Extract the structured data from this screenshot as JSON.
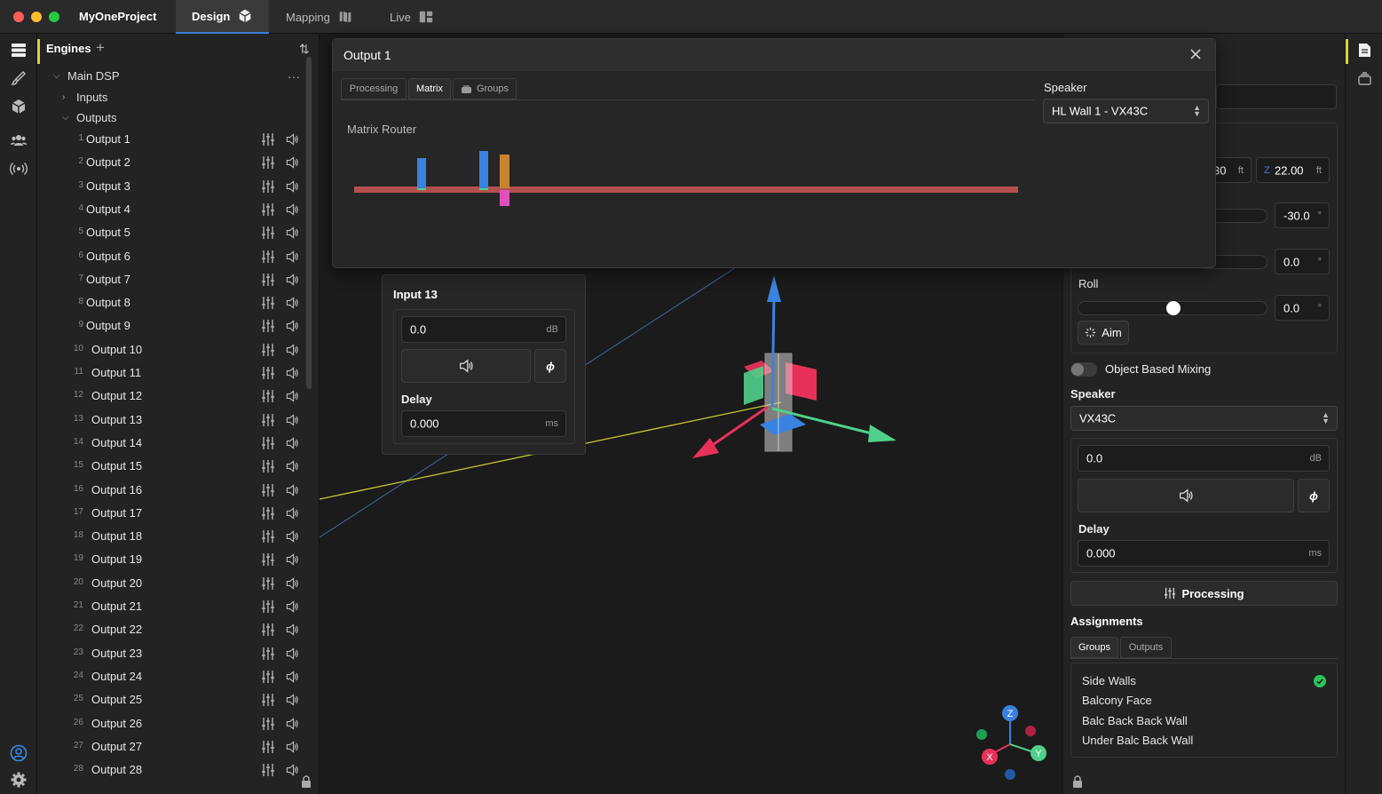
{
  "app": {
    "title": "MyOneProject",
    "tabs": [
      {
        "label": "Design",
        "active": true
      },
      {
        "label": "Mapping",
        "active": false
      },
      {
        "label": "Live",
        "active": false
      }
    ]
  },
  "engines": {
    "header": "Engines",
    "add": "+",
    "sort": "⇅",
    "main_dsp": "Main DSP",
    "more": "···",
    "inputs": "Inputs",
    "outputs": "Outputs",
    "items": [
      {
        "num": "1",
        "label": "Output 1"
      },
      {
        "num": "2",
        "label": "Output 2"
      },
      {
        "num": "3",
        "label": "Output 3"
      },
      {
        "num": "4",
        "label": "Output 4"
      },
      {
        "num": "5",
        "label": "Output 5"
      },
      {
        "num": "6",
        "label": "Output 6"
      },
      {
        "num": "7",
        "label": "Output 7"
      },
      {
        "num": "8",
        "label": "Output 8"
      },
      {
        "num": "9",
        "label": "Output 9"
      },
      {
        "num": "10",
        "label": "Output 10"
      },
      {
        "num": "11",
        "label": "Output 11"
      },
      {
        "num": "12",
        "label": "Output 12"
      },
      {
        "num": "13",
        "label": "Output 13"
      },
      {
        "num": "14",
        "label": "Output 14"
      },
      {
        "num": "15",
        "label": "Output 15"
      },
      {
        "num": "16",
        "label": "Output 16"
      },
      {
        "num": "17",
        "label": "Output 17"
      },
      {
        "num": "18",
        "label": "Output 18"
      },
      {
        "num": "19",
        "label": "Output 19"
      },
      {
        "num": "20",
        "label": "Output 20"
      },
      {
        "num": "21",
        "label": "Output 21"
      },
      {
        "num": "22",
        "label": "Output 22"
      },
      {
        "num": "23",
        "label": "Output 23"
      },
      {
        "num": "24",
        "label": "Output 24"
      },
      {
        "num": "25",
        "label": "Output 25"
      },
      {
        "num": "26",
        "label": "Output 26"
      },
      {
        "num": "27",
        "label": "Output 27"
      },
      {
        "num": "28",
        "label": "Output 28"
      }
    ]
  },
  "dialog": {
    "title": "Output 1",
    "tabs": [
      {
        "label": "Processing",
        "active": false
      },
      {
        "label": "Matrix",
        "active": true
      },
      {
        "label": "Groups",
        "active": false
      }
    ],
    "matrix_label": "Matrix Router",
    "speaker_label": "Speaker",
    "speaker_value": "HL Wall 1 - VX43C"
  },
  "input_panel": {
    "title": "Input 13",
    "gain": "0.0",
    "gain_unit": "dB",
    "delay_label": "Delay",
    "delay": "0.000",
    "delay_unit": "ms",
    "phase": "ϕ"
  },
  "props": {
    "position_x_partial": "30",
    "position_x_unit": "ft",
    "position_z_axis": "Z",
    "position_z": "22.00",
    "position_z_unit": "ft",
    "yaw_value": "-30.0",
    "pitch_value": "0.0",
    "roll_label": "Roll",
    "roll_value": "0.0",
    "deg": "°",
    "roll_fraction": 0.5,
    "aim_label": "Aim",
    "object_mixing_label": "Object Based Mixing",
    "object_mixing_on": false,
    "speaker_label": "Speaker",
    "speaker_value": "VX43C",
    "gain": "0.0",
    "gain_unit": "dB",
    "phase": "ϕ",
    "delay_label": "Delay",
    "delay": "0.000",
    "delay_unit": "ms",
    "processing_label": "Processing",
    "assignments_label": "Assignments",
    "assign_tabs": [
      {
        "label": "Groups",
        "active": true
      },
      {
        "label": "Outputs",
        "active": false
      }
    ],
    "groups": [
      {
        "label": "Side Walls",
        "checked": true
      },
      {
        "label": "Balcony Face",
        "checked": false
      },
      {
        "label": "Balc Back Back Wall",
        "checked": false
      },
      {
        "label": "Under Balc Back Wall",
        "checked": false
      }
    ]
  },
  "gizmo": {
    "x": "X",
    "y": "Y",
    "z": "Z"
  },
  "colors": {
    "accent_yellow": "#d8d23a",
    "tab_blue": "#3b7fd9",
    "axis_x": "#e8315a",
    "axis_y": "#4fd08a",
    "axis_z": "#3a82e0",
    "check_green": "#2bc45b"
  }
}
